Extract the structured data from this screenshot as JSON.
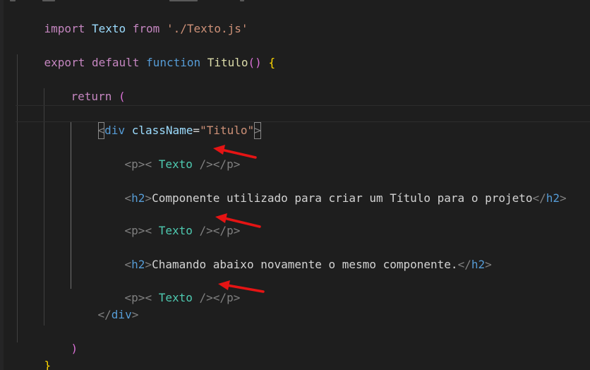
{
  "code": {
    "line1": {
      "kw_import": "import",
      "ident": "Texto",
      "kw_from": "from",
      "module": "'./Texto.js'"
    },
    "line2": {
      "kw_export": "export",
      "kw_default": "default",
      "kw_function": "function",
      "name": "Titulo",
      "parens": "()",
      "brace_open": "{"
    },
    "line3": {
      "kw_return": "return",
      "paren_open": "("
    },
    "line4": {
      "lt": "<",
      "tag": "div",
      "attr": "className",
      "eq": "=",
      "value": "\"Titulo\"",
      "gt": ">"
    },
    "line5": {
      "open": "<p>",
      "lt": "<",
      "comp": "Texto",
      "selfclose": "/>",
      "close": "</p>"
    },
    "line6": {
      "open_lt": "<",
      "open_tag": "h2",
      "open_gt": ">",
      "text": "Componente utilizado para criar um Título para o projeto",
      "close_lt": "</",
      "close_tag": "h2",
      "close_gt": ">"
    },
    "line7": {
      "open": "<p>",
      "lt": "<",
      "comp": "Texto",
      "selfclose": "/>",
      "close": "</p>"
    },
    "line8": {
      "open_lt": "<",
      "open_tag": "h2",
      "open_gt": ">",
      "text": "Chamando abaixo novamente o mesmo componente.",
      "close_lt": "</",
      "close_tag": "h2",
      "close_gt": ">"
    },
    "line9": {
      "open": "<p>",
      "lt": "<",
      "comp": "Texto",
      "selfclose": "/>",
      "close": "</p>"
    },
    "line10": {
      "lt": "</",
      "tag": "div",
      "gt": ">"
    },
    "line11": {
      "paren_close": ")"
    },
    "line12": {
      "brace_close": "}"
    }
  },
  "annotation": {
    "arrow_color": "#e51414",
    "arrow_count": 3
  }
}
